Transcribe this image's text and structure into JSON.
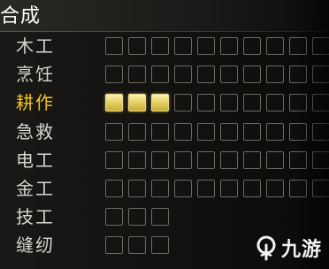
{
  "title": "合成",
  "rows": [
    {
      "label": "木工",
      "level": 0,
      "slots": 10
    },
    {
      "label": "烹饪",
      "level": 0,
      "slots": 10
    },
    {
      "label": "耕作",
      "level": 3,
      "slots": 10,
      "active": true
    },
    {
      "label": "急救",
      "level": 0,
      "slots": 10
    },
    {
      "label": "电工",
      "level": 0,
      "slots": 10
    },
    {
      "label": "金工",
      "level": 0,
      "slots": 10
    },
    {
      "label": "技工",
      "level": 0,
      "slots": 3
    },
    {
      "label": "缝纫",
      "level": 0,
      "slots": 3
    }
  ],
  "watermark": {
    "text": "九游",
    "icon": "jiuyou-logo"
  },
  "colors": {
    "active_label": "#f3c520",
    "filled_box": "#e7d36a"
  }
}
